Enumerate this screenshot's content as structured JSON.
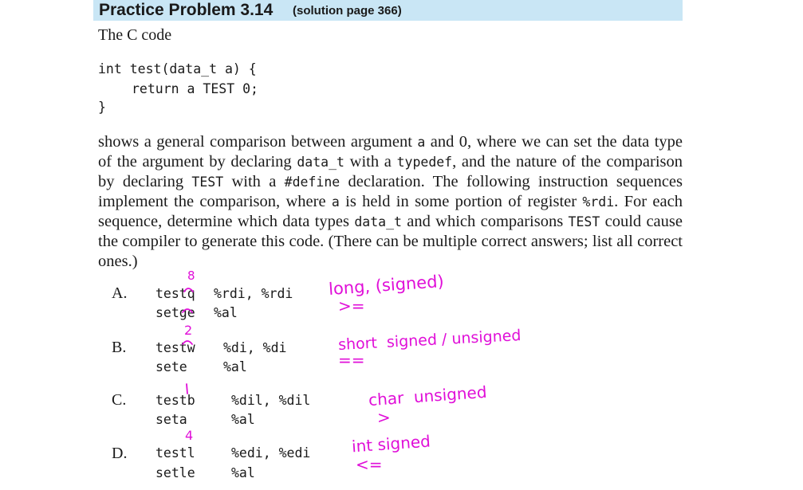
{
  "header": {
    "title": "Practice Problem 3.14",
    "solution_ref": "(solution page 366)"
  },
  "intro": "The C code",
  "code": {
    "line1": "int test(data_t a) {",
    "line2": "return a TEST 0;",
    "line3": "}"
  },
  "paragraph": {
    "s1": "shows a general comparison between argument ",
    "c1": "a",
    "s2": " and 0, where we can set the data type of the argument by declaring ",
    "c2": "data_t",
    "s3": " with a ",
    "c3": "typedef",
    "s4": ", and the nature of the comparison by declaring ",
    "c4": "TEST",
    "s5": " with a ",
    "c5": "#define",
    "s6": " declaration. The following instruction sequences implement the comparison, where ",
    "c6": "a",
    "s7": " is held in some portion of register ",
    "c7": "%rdi",
    "s8": ". For each sequence, determine which data types ",
    "c8": "data_t",
    "s9": " and which comparisons ",
    "c9": "TEST",
    "s10": " could cause the compiler to generate this code. (There can be multiple correct answers; list all correct ones.)"
  },
  "problems": [
    {
      "letter": "A.",
      "instr1": "testq",
      "ops1": "%rdi, %rdi",
      "instr2": "setge",
      "ops2": "%al"
    },
    {
      "letter": "B.",
      "instr1": "testw",
      "ops1": "%di, %di",
      "instr2": "sete",
      "ops2": "%al"
    },
    {
      "letter": "C.",
      "instr1": "testb",
      "ops1": "%dil, %dil",
      "instr2": "seta",
      "ops2": "%al"
    },
    {
      "letter": "D.",
      "instr1": "testl",
      "ops1": "%edi, %edi",
      "instr2": "setle",
      "ops2": "%al"
    }
  ],
  "annotations": {
    "a_size": "8",
    "a_type": "long, (signed)",
    "a_op": ">=",
    "b_size": "2",
    "b_type": "short  signed / unsigned",
    "b_op": "==",
    "c_type": "char  unsigned",
    "c_op": ">",
    "d_size": "4",
    "d_type": "int signed",
    "d_op": "<="
  },
  "colors": {
    "title_bg": "#c9e6f5",
    "ink": "#e00fd8"
  }
}
